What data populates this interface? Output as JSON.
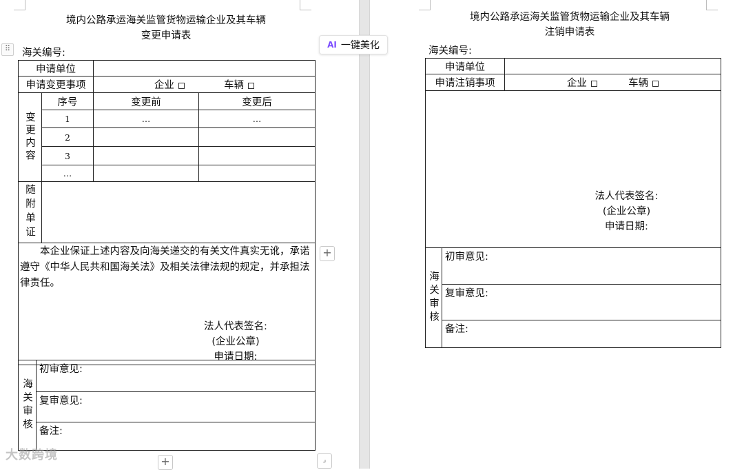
{
  "left_form": {
    "title_line1": "境内公路承运海关监管货物运输企业及其车辆",
    "title_line2": "变更申请表",
    "customs_no_label": "海关编号:",
    "applicant_label": "申请单位",
    "change_item_label": "申请变更事项",
    "enterprise_option": "企业",
    "vehicle_option": "车辆",
    "change_content_label": "变更内容",
    "col_seq": "序号",
    "col_before": "变更前",
    "col_after": "变更后",
    "rows": [
      {
        "seq": "1",
        "before": "…",
        "after": "…"
      },
      {
        "seq": "2",
        "before": "",
        "after": ""
      },
      {
        "seq": "3",
        "before": "",
        "after": ""
      },
      {
        "seq": "…",
        "before": "",
        "after": ""
      }
    ],
    "attachments_label": "随附单证",
    "declaration": "本企业保证上述内容及向海关递交的有关文件真实无讹，承诺遵守《中华人民共和国海关法》及相关法律法规的规定，并承担法律责任。",
    "signature_label": "法人代表签名:",
    "seal_label": "(企业公章)",
    "date_label": "申请日期:",
    "review_label": "海关审核",
    "first_review": "初审意见:",
    "second_review": "复审意见:",
    "remarks": "备注:"
  },
  "right_form": {
    "title_line1": "境内公路承运海关监管货物运输企业及其车辆",
    "title_line2": "注销申请表",
    "customs_no_label": "海关编号:",
    "applicant_label": "申请单位",
    "cancel_item_label": "申请注销事项",
    "enterprise_option": "企业",
    "vehicle_option": "车辆",
    "signature_label": "法人代表签名:",
    "seal_label": "(企业公章)",
    "date_label": "申请日期:",
    "review_label": "海关审核",
    "first_review": "初审意见:",
    "second_review": "复审意见:",
    "remarks": "备注:"
  },
  "toolbar": {
    "ai_icon_text": "AI",
    "ai_beautify_label": "一键美化",
    "plus_symbol": "+"
  },
  "watermark_text": "大数跨境",
  "colors": {
    "ai_accent": "#7b4cff",
    "border": "#222222",
    "divider": "#e6e6e6"
  }
}
